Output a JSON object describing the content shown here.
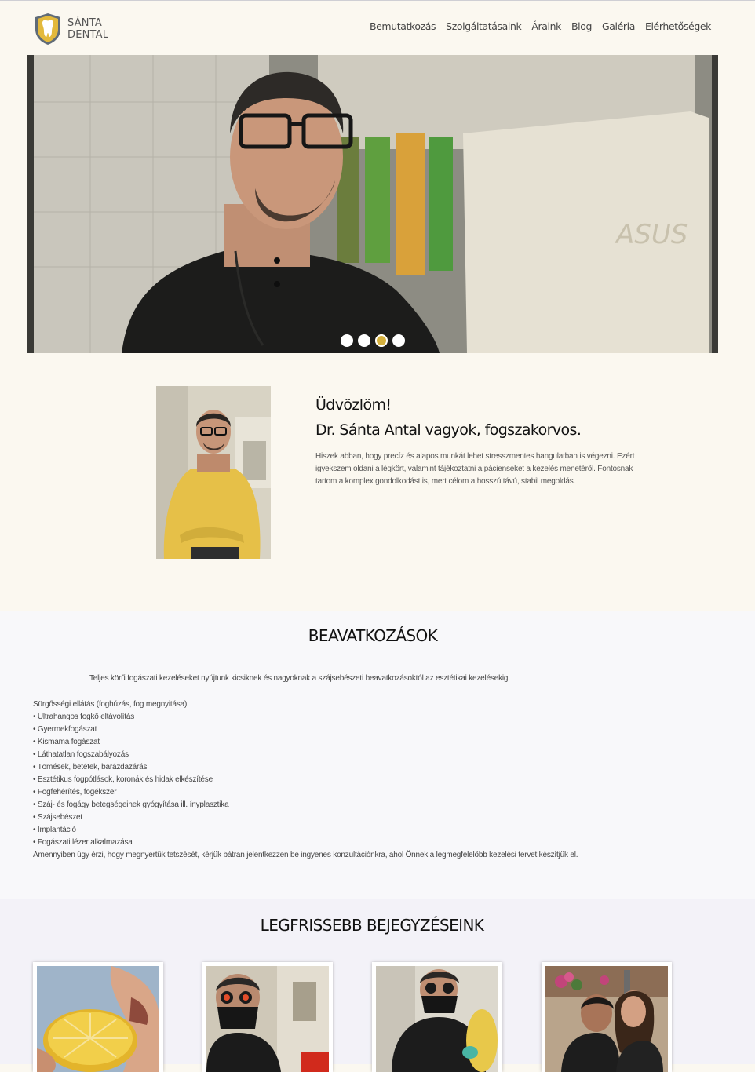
{
  "brand": {
    "line1": "SÁNTA",
    "line2": "DENTAL"
  },
  "nav": [
    {
      "label": "Bemutatkozás"
    },
    {
      "label": "Szolgáltatásaink"
    },
    {
      "label": "Áraink"
    },
    {
      "label": "Blog"
    },
    {
      "label": "Galéria"
    },
    {
      "label": "Elérhetőségek"
    }
  ],
  "slider": {
    "active_index": 2,
    "dots": 4
  },
  "intro": {
    "greeting": "Üdvözlöm!",
    "name_line": "Dr. Sánta Antal vagyok, fogszakorvos.",
    "body": "Hiszek abban, hogy precíz és alapos munkát lehet stresszmentes hangulatban is végezni. Ezért igyekszem oldani a légkört, valamint tájékoztatni a pácienseket a kezelés menetéről. Fontosnak tartom a komplex gondolkodást is, mert célom a hosszú távú, stabil megoldás."
  },
  "procedures": {
    "title": "BEAVATKOZÁSOK",
    "lead": "Teljes körű fogászati kezeléseket nyújtunk kicsiknek és nagyoknak a szájsebészeti beavatkozásoktól az esztétikai kezelésekig.",
    "items": [
      "Sürgősségi ellátás (foghúzás, fog megnyitása)",
      "• Ultrahangos fogkő eltávolítás",
      "• Gyermekfogászat",
      "• Kismama fogászat",
      "• Láthatatlan fogszabályozás",
      "• Tömések, betétek, barázdazárás",
      "• Esztétikus fogpótlások, koronák és hidak elkészítése",
      "• Fogfehérítés, fogékszer",
      "• Száj- és fogágy betegségeinek gyógyítása ill. ínyplasztika",
      "• Szájsebészet",
      "• Implantáció",
      "• Fogászati lézer alkalmazása"
    ],
    "outro": "Amennyiben úgy érzi, hogy megnyertük tetszését, kérjük bátran jelentkezzen be ingyenes konzultációnkra, ahol Önnek a legmegfelelőbb kezelési tervet készítjük el."
  },
  "posts": {
    "title": "LEGFRISSEBB BEJEGYZÉSEINK",
    "cards": [
      {
        "image": "lemon-photo"
      },
      {
        "image": "dentist-loupes-photo"
      },
      {
        "image": "dentist-working-photo"
      },
      {
        "image": "couple-photo"
      }
    ]
  },
  "colors": {
    "accent": "#d6b13d",
    "background": "#fbf8f0"
  }
}
